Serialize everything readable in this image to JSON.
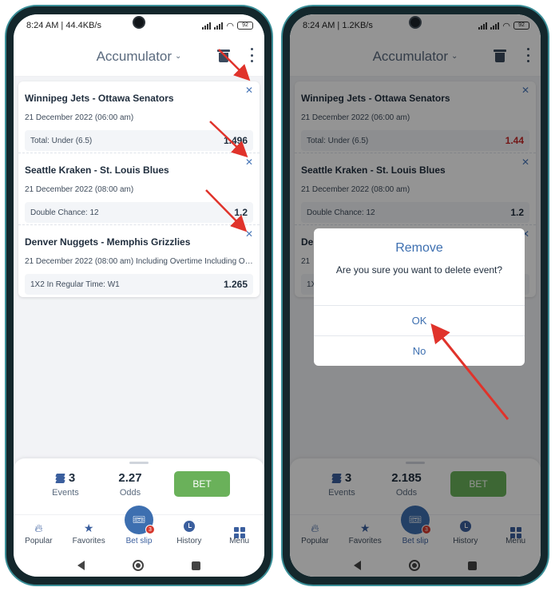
{
  "left": {
    "status": {
      "time": "8:24 AM | 44.4KB/s",
      "battery": "92"
    },
    "header": {
      "title": "Accumulator"
    },
    "events": [
      {
        "teams": "Winnipeg Jets - Ottawa Senators",
        "date": "21 December 2022 (06:00 am)",
        "market": "Total: Under (6.5)",
        "odd": "1.496"
      },
      {
        "teams": "Seattle Kraken - St. Louis Blues",
        "date": "21 December 2022 (08:00 am)",
        "market": "Double Chance: 12",
        "odd": "1.2"
      },
      {
        "teams": "Denver Nuggets - Memphis Grizzlies",
        "date": "21 December 2022 (08:00 am) Including Overtime Including Overt...",
        "market": "1X2 In Regular Time: W1",
        "odd": "1.265"
      }
    ],
    "summary": {
      "events_count": "3",
      "events_label": "Events",
      "odds_value": "2.27",
      "odds_label": "Odds",
      "bet_label": "BET"
    }
  },
  "right": {
    "status": {
      "time": "8:24 AM | 1.2KB/s",
      "battery": "92"
    },
    "header": {
      "title": "Accumulator"
    },
    "events": [
      {
        "teams": "Winnipeg Jets - Ottawa Senators",
        "date": "21 December 2022 (06:00 am)",
        "market": "Total: Under (6.5)",
        "odd": "1.44"
      },
      {
        "teams": "Seattle Kraken - St. Louis Blues",
        "date": "21 December 2022 (08:00 am)",
        "market": "Double Chance: 12",
        "odd": "1.2"
      },
      {
        "teams": "De",
        "date": "21",
        "market": "1X",
        "odd": "55"
      }
    ],
    "summary": {
      "events_count": "3",
      "events_label": "Events",
      "odds_value": "2.185",
      "odds_label": "Odds",
      "bet_label": "BET"
    },
    "dialog": {
      "title": "Remove",
      "message": "Are you sure you want to delete event?",
      "ok": "OK",
      "no": "No"
    }
  },
  "nav": {
    "popular": "Popular",
    "favorites": "Favorites",
    "betslip": "Bet slip",
    "history": "History",
    "menu": "Menu",
    "betslip_badge": "3"
  },
  "colors": {
    "accent": "#3d6fb0",
    "bet_button": "#6ab15a",
    "arrow": "#e0332b",
    "badge": "#d6382e",
    "odd_changed": "#c62828"
  },
  "icons": {
    "close": "close-icon",
    "trash": "trash-icon",
    "more": "kebab-icon",
    "layers": "layers-icon"
  }
}
